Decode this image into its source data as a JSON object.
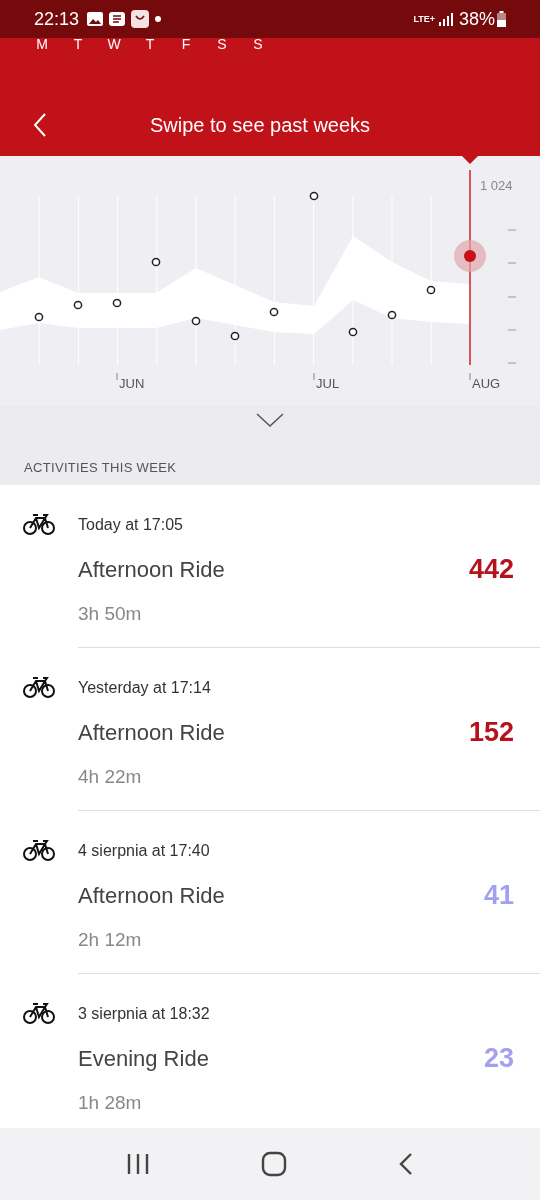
{
  "status_bar": {
    "time": "22:13",
    "network": "LTE+",
    "battery": "38%"
  },
  "week_days": [
    "M",
    "T",
    "W",
    "T",
    "F",
    "S",
    "S"
  ],
  "header": {
    "title": "Swipe to see past weeks"
  },
  "chart": {
    "top_label": "1 024",
    "months": [
      "JUN",
      "JUL",
      "AUG"
    ]
  },
  "section_title": "ACTIVITIES THIS WEEK",
  "activities": [
    {
      "when": "Today at 17:05",
      "name": "Afternoon Ride",
      "duration": "3h 50m",
      "score": "442",
      "color": "#b5121b"
    },
    {
      "when": "Yesterday at 17:14",
      "name": "Afternoon Ride",
      "duration": "4h 22m",
      "score": "152",
      "color": "#b5121b"
    },
    {
      "when": "4 sierpnia at 17:40",
      "name": "Afternoon Ride",
      "duration": "2h 12m",
      "score": "41",
      "color": "#a59ff0"
    },
    {
      "when": "3 sierpnia at 18:32",
      "name": "Evening Ride",
      "duration": "1h 28m",
      "score": "23",
      "color": "#a59ff0"
    }
  ]
}
